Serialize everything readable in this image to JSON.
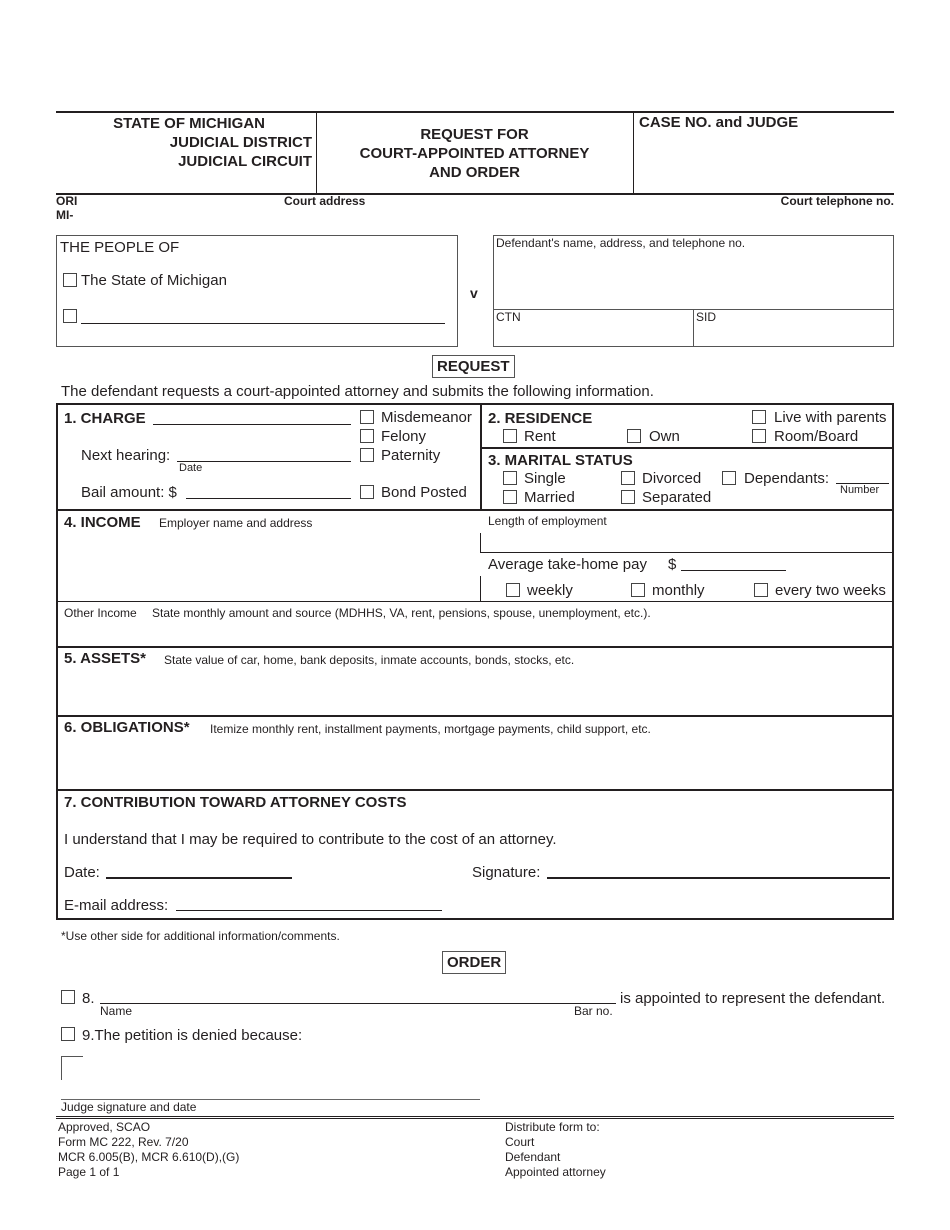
{
  "header": {
    "state": "STATE OF MICHIGAN",
    "district": "JUDICIAL DISTRICT",
    "circuit": "JUDICIAL CIRCUIT",
    "title_line1": "REQUEST FOR",
    "title_line2": "COURT-APPOINTED ATTORNEY",
    "title_line3": "AND ORDER",
    "case_label": "CASE NO. and JUDGE",
    "ori_label": "ORI",
    "ori_prefix": "MI-",
    "court_address_label": "Court address",
    "court_phone_label": "Court telephone no."
  },
  "parties": {
    "people_of": "THE PEOPLE OF",
    "state_option": "The State of Michigan",
    "versus": "v",
    "defendant_label": "Defendant's name, address, and telephone no.",
    "ctn_label": "CTN",
    "sid_label": "SID"
  },
  "request": {
    "heading": "REQUEST",
    "intro": "The defendant requests a court-appointed attorney and submits the following information."
  },
  "charge": {
    "label": "1. CHARGE",
    "next_hearing": "Next hearing:",
    "date_caption": "Date",
    "bail": "Bail amount: $",
    "options": [
      "Misdemeanor",
      "Felony",
      "Paternity"
    ],
    "bond_posted": "Bond Posted"
  },
  "residence": {
    "label": "2. RESIDENCE",
    "options": [
      "Rent",
      "Own",
      "Live with parents",
      "Room/Board"
    ]
  },
  "marital": {
    "label": "3. MARITAL STATUS",
    "options": [
      "Single",
      "Married",
      "Divorced",
      "Separated"
    ],
    "dependants": "Dependants:",
    "number_caption": "Number"
  },
  "income": {
    "label": "4. INCOME",
    "employer": "Employer name and address",
    "length": "Length of employment",
    "avg_pay": "Average take-home pay",
    "currency": "$",
    "frequency": [
      "weekly",
      "monthly",
      "every two weeks"
    ],
    "other_label": "Other Income",
    "other_desc": "State monthly amount and source (MDHHS, VA, rent, pensions, spouse, unemployment, etc.)."
  },
  "assets": {
    "label": "5. ASSETS*",
    "desc": "State value of car, home, bank deposits, inmate accounts, bonds, stocks, etc."
  },
  "obligations": {
    "label": "6. OBLIGATIONS*",
    "desc": "Itemize monthly rent, installment payments, mortgage payments, child support, etc."
  },
  "contribution": {
    "label": "7. CONTRIBUTION TOWARD ATTORNEY COSTS",
    "statement": "I understand that I may be required to contribute to the cost of an attorney.",
    "date": "Date:",
    "signature": "Signature:",
    "email": "E-mail address:"
  },
  "note": "*Use other side for additional information/comments.",
  "order": {
    "heading": "ORDER",
    "item8_num": "8.",
    "name_caption": "Name",
    "bar_caption": "Bar no.",
    "item8_text": "is appointed to represent the defendant.",
    "item9": "9.The petition is denied because:",
    "judge_sig": "Judge signature and date"
  },
  "footer": {
    "left": [
      "Approved, SCAO",
      "Form MC 222, Rev. 7/20",
      "MCR 6.005(B), MCR 6.610(D),(G)",
      "Page 1 of 1"
    ],
    "distribute_label": "Distribute form to:",
    "distribute": [
      "Court",
      "Defendant",
      "Appointed attorney"
    ]
  }
}
